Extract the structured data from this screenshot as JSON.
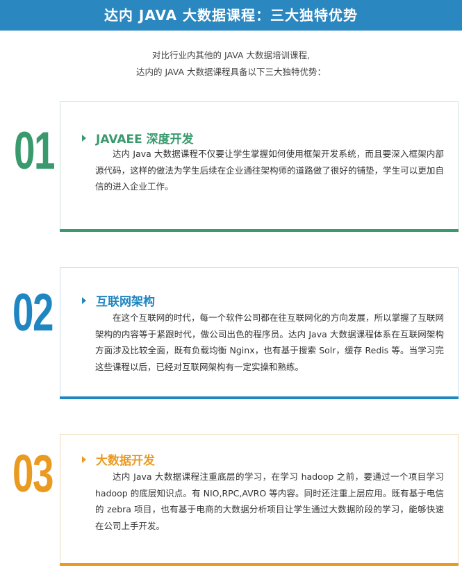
{
  "header": {
    "title": "达内 JAVA 大数据课程：三大独特优势"
  },
  "intro": {
    "line1": "对比行业内其他的 JAVA 大数据培训课程,",
    "line2": "达内的 JAVA 大数据课程具备以下三大独特优势："
  },
  "colors": {
    "banner": "#2a87c0",
    "green": "#3a9a6e",
    "blue": "#1f86c1",
    "orange": "#e99a21"
  },
  "sections": [
    {
      "number": "01",
      "icon": "play-triangle-icon",
      "title": "JAVAEE 深度开发",
      "text": "达内 Java 大数据课程不仅要让学生掌握如何使用框架开发系统，而且要深入框架内部源代码，这样的做法为学生后续在企业通往架构师的道路做了很好的铺垫，学生可以更加自信的进入企业工作。"
    },
    {
      "number": "02",
      "icon": "play-triangle-icon",
      "title": "互联网架构",
      "text": "在这个互联网的时代，每一个软件公司都在往互联网化的方向发展，所以掌握了互联网架构的内容等于紧跟时代，做公司出色的程序员。达内 Java 大数据课程体系在互联网架构方面涉及比较全面，既有负载均衡 Nginx，也有基于搜索 Solr，缓存 Redis 等。当学习完这些课程以后，已经对互联网架构有一定实操和熟练。"
    },
    {
      "number": "03",
      "icon": "play-triangle-icon",
      "title": "大数据开发",
      "text": "达内 Java 大数据课程注重底层的学习，在学习 hadoop 之前，要通过一个项目学习 hadoop 的底层知识点。有 NIO,RPC,AVRO 等内容。同时还注重上层应用。既有基于电信的 zebra 项目，也有基于电商的大数据分析项目让学生通过大数据阶段的学习，能够快速在公司上手开发。"
    }
  ]
}
